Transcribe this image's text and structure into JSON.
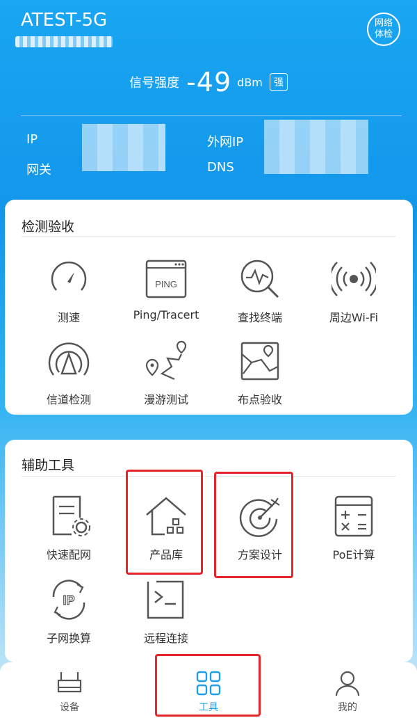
{
  "header": {
    "ssid": "ATEST-5G",
    "check_button": "网络体检",
    "signal_label": "信号强度",
    "signal_value": "-49",
    "signal_unit": "dBm",
    "signal_quality": "强",
    "ip_label": "IP",
    "gateway_label": "网关",
    "wan_ip_label": "外网IP",
    "dns_label": "DNS"
  },
  "detect": {
    "title": "检测验收",
    "items": [
      {
        "label": "测速",
        "icon": "speedometer-icon"
      },
      {
        "label": "Ping/Tracert",
        "icon": "ping-window-icon",
        "icon_text": "PING"
      },
      {
        "label": "查找终端",
        "icon": "search-pulse-icon"
      },
      {
        "label": "周边Wi-Fi",
        "icon": "wifi-broadcast-icon"
      },
      {
        "label": "信道检测",
        "icon": "channel-icon"
      },
      {
        "label": "漫游测试",
        "icon": "roaming-route-icon"
      },
      {
        "label": "布点验收",
        "icon": "placement-map-icon"
      }
    ]
  },
  "assist": {
    "title": "辅助工具",
    "items": [
      {
        "label": "快速配网",
        "icon": "quick-config-icon"
      },
      {
        "label": "产品库",
        "icon": "product-library-icon"
      },
      {
        "label": "方案设计",
        "icon": "target-design-icon"
      },
      {
        "label": "PoE计算",
        "icon": "calculator-icon"
      },
      {
        "label": "子网换算",
        "icon": "subnet-ip-icon",
        "icon_text": "IP"
      },
      {
        "label": "远程连接",
        "icon": "terminal-icon"
      }
    ]
  },
  "tabs": [
    {
      "label": "设备",
      "icon": "router-icon"
    },
    {
      "label": "工具",
      "icon": "grid-icon"
    },
    {
      "label": "我的",
      "icon": "user-icon"
    }
  ],
  "colors": {
    "accent": "#1c9fe8",
    "highlight": "#e8242a",
    "icon_stroke": "#555555"
  }
}
